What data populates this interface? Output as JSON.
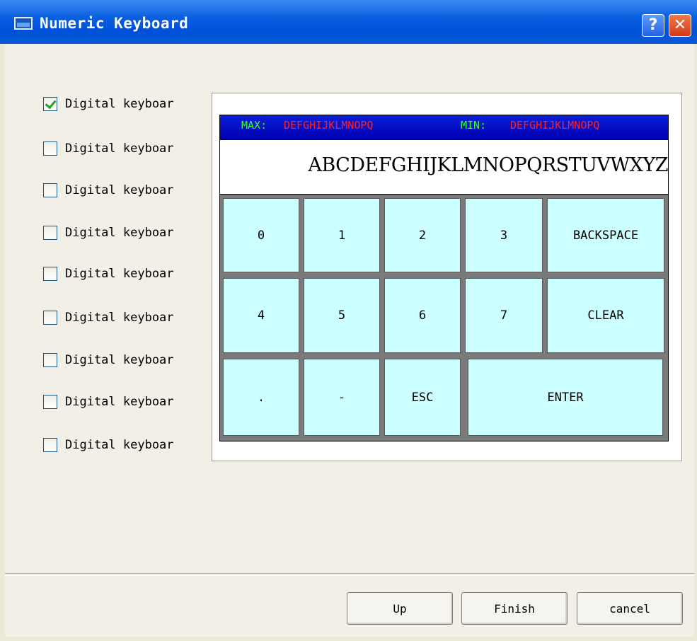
{
  "window": {
    "title": "Numeric Keyboard",
    "help_label": "?",
    "close_label": "✕"
  },
  "checkboxes": [
    {
      "label": "Digital keyboar",
      "checked": true
    },
    {
      "label": "Digital keyboar",
      "checked": false
    },
    {
      "label": "Digital keyboar",
      "checked": false
    },
    {
      "label": "Digital keyboar",
      "checked": false
    },
    {
      "label": "Digital keyboar",
      "checked": false
    },
    {
      "label": "Digital keyboar",
      "checked": false
    },
    {
      "label": "Digital keyboar",
      "checked": false
    },
    {
      "label": "Digital keyboar",
      "checked": false
    },
    {
      "label": "Digital keyboar",
      "checked": false
    }
  ],
  "preview": {
    "max_label": "MAX:",
    "max_value": "DEFGHIJKLMNOPQ",
    "min_label": "MIN:",
    "min_value": "DEFGHIJKLMNOPQ",
    "display_text": "ABCDEFGHIJKLMNOPQRSTUVWXYZ",
    "keys": {
      "k0": "0",
      "k1": "1",
      "k2": "2",
      "k3": "3",
      "backspace": "BACKSPACE",
      "k4": "4",
      "k5": "5",
      "k6": "6",
      "k7": "7",
      "clear": "CLEAR",
      "dot": ".",
      "minus": "-",
      "esc": "ESC",
      "enter": "ENTER"
    }
  },
  "buttons": {
    "up": "Up",
    "finish": "Finish",
    "cancel": "cancel"
  },
  "colors": {
    "key_bg": "#ccffff",
    "label_green": "#33ff33",
    "value_red": "#ff2020",
    "header_blue": "#0a1fd8"
  }
}
